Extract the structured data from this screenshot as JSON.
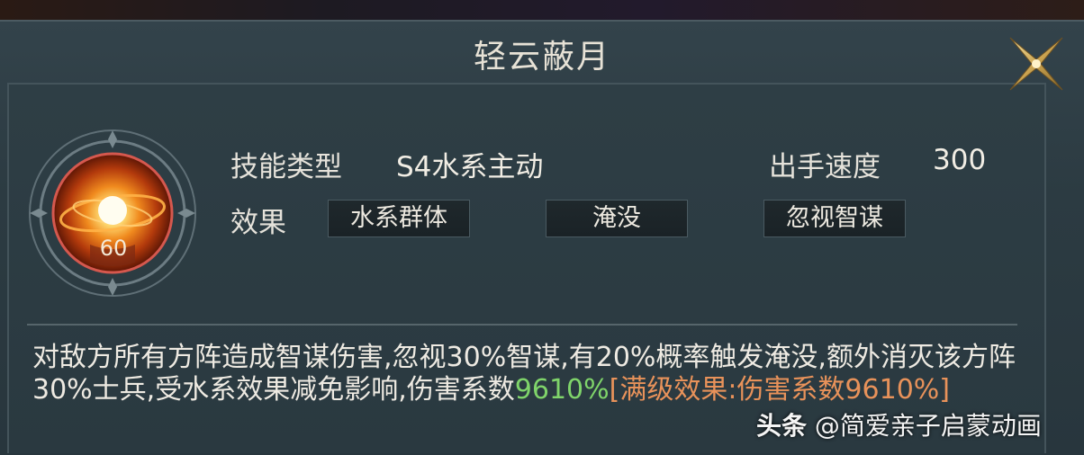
{
  "dialog": {
    "title": "轻云蔽月"
  },
  "skill": {
    "level": "60",
    "type_label": "技能类型",
    "type_value": "S4水系主动",
    "speed_label": "出手速度",
    "speed_value": "300",
    "effect_label": "效果",
    "effects": [
      "水系群体",
      "淹没",
      "忽视智谋"
    ]
  },
  "description": {
    "main": "对敌方所有方阵造成智谋伤害,忽视30%智谋,有20%概率触发淹没,额外消灭该方阵30%士兵,受水系效果减免影响,伤害系数",
    "coefficient": "9610%",
    "max_effect": "[满级效果:伤害系数9610%]"
  },
  "watermark": {
    "brand": "头条",
    "account": "@简爱亲子启蒙动画"
  },
  "colors": {
    "coefficient": "#7fd46a",
    "max_effect": "#e8925a"
  },
  "icons": {
    "close": "close-x-icon",
    "skill": "sun-vortex-skill-icon"
  }
}
